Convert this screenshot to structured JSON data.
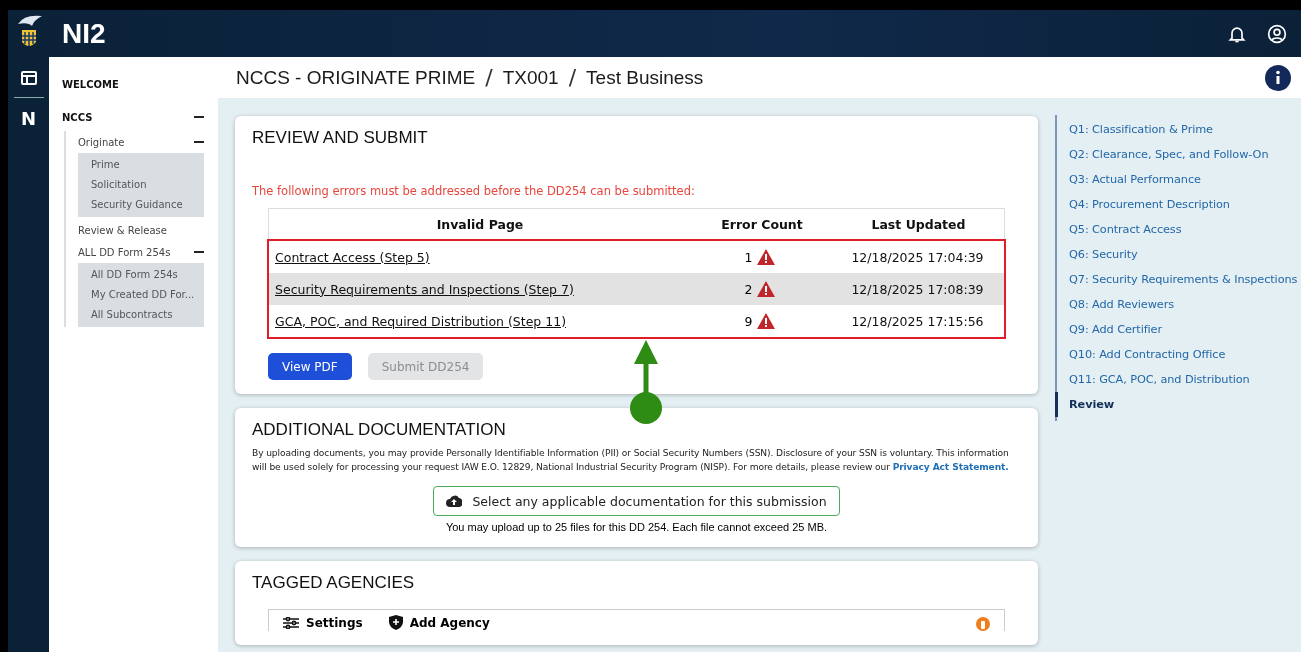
{
  "header": {
    "app_name": "NI2"
  },
  "rail": {
    "letter": "N"
  },
  "sidebar": {
    "items": [
      {
        "label": "WELCOME"
      },
      {
        "label": "NCCS",
        "expanded": true,
        "children": [
          {
            "label": "Originate",
            "expanded": true,
            "children": [
              {
                "label": "Prime"
              },
              {
                "label": "Solicitation"
              },
              {
                "label": "Security Guidance"
              }
            ]
          },
          {
            "label": "Review & Release"
          },
          {
            "label": "ALL DD Form 254s",
            "expanded": true,
            "children": [
              {
                "label": "All DD Form 254s"
              },
              {
                "label": "My Created DD For..."
              },
              {
                "label": "All Subcontracts"
              }
            ]
          }
        ]
      }
    ]
  },
  "breadcrumb": {
    "separator": "/",
    "items": [
      "NCCS - ORIGINATE PRIME",
      "TX001",
      "Test Business"
    ]
  },
  "review": {
    "title": "REVIEW AND SUBMIT",
    "error_message": "The following errors must be addressed before the DD254 can be submitted:",
    "columns": [
      "Invalid Page",
      "Error Count",
      "Last Updated"
    ],
    "rows": [
      {
        "page": "Contract Access (Step 5)",
        "count": "1",
        "updated": "12/18/2025 17:04:39",
        "shaded": false
      },
      {
        "page": "Security Requirements and Inspections (Step 7)",
        "count": "2",
        "updated": "12/18/2025 17:08:39",
        "shaded": true
      },
      {
        "page": "GCA, POC, and Required Distribution (Step 11)",
        "count": "9",
        "updated": "12/18/2025 17:15:56",
        "shaded": false
      }
    ],
    "buttons": [
      {
        "label": "View PDF",
        "disabled": false
      },
      {
        "label": "Submit DD254",
        "disabled": true
      }
    ]
  },
  "additional": {
    "title": "ADDITIONAL DOCUMENTATION",
    "disclosure": "By uploading documents, you may provide Personally Identifiable Information (PII) or Social Security Numbers (SSN). Disclosure of your SSN is voluntary. This information will be used solely for processing your request IAW E.O. 12829, National Industrial Security Program (NISP). For more details, please review our",
    "link": "Privacy Act Statement.",
    "upload_button": "Select any applicable documentation for this submission",
    "upload_note": "You may upload up to 25 files for this DD 254.  Each file cannot exceed 25 MB."
  },
  "tagged": {
    "title": "TAGGED AGENCIES",
    "toolbar": [
      {
        "kind": "settings",
        "label": "Settings"
      },
      {
        "kind": "add",
        "label": "Add Agency"
      }
    ]
  },
  "step_nav": {
    "items": [
      {
        "label": "Q1: Classification & Prime",
        "selected": false
      },
      {
        "label": "Q2: Clearance, Spec, and Follow-On",
        "selected": false
      },
      {
        "label": "Q3: Actual Performance",
        "selected": false
      },
      {
        "label": "Q4: Procurement Description",
        "selected": false
      },
      {
        "label": "Q5: Contract Access",
        "selected": false
      },
      {
        "label": "Q6: Security",
        "selected": false
      },
      {
        "label": "Q7: Security Requirements & Inspections",
        "selected": false
      },
      {
        "label": "Q8: Add Reviewers",
        "selected": false
      },
      {
        "label": "Q9: Add Certifier",
        "selected": false
      },
      {
        "label": "Q10: Add Contracting Office",
        "selected": false
      },
      {
        "label": "Q11: GCA, POC, and Distribution",
        "selected": false
      },
      {
        "label": "Review",
        "selected": true
      }
    ]
  }
}
